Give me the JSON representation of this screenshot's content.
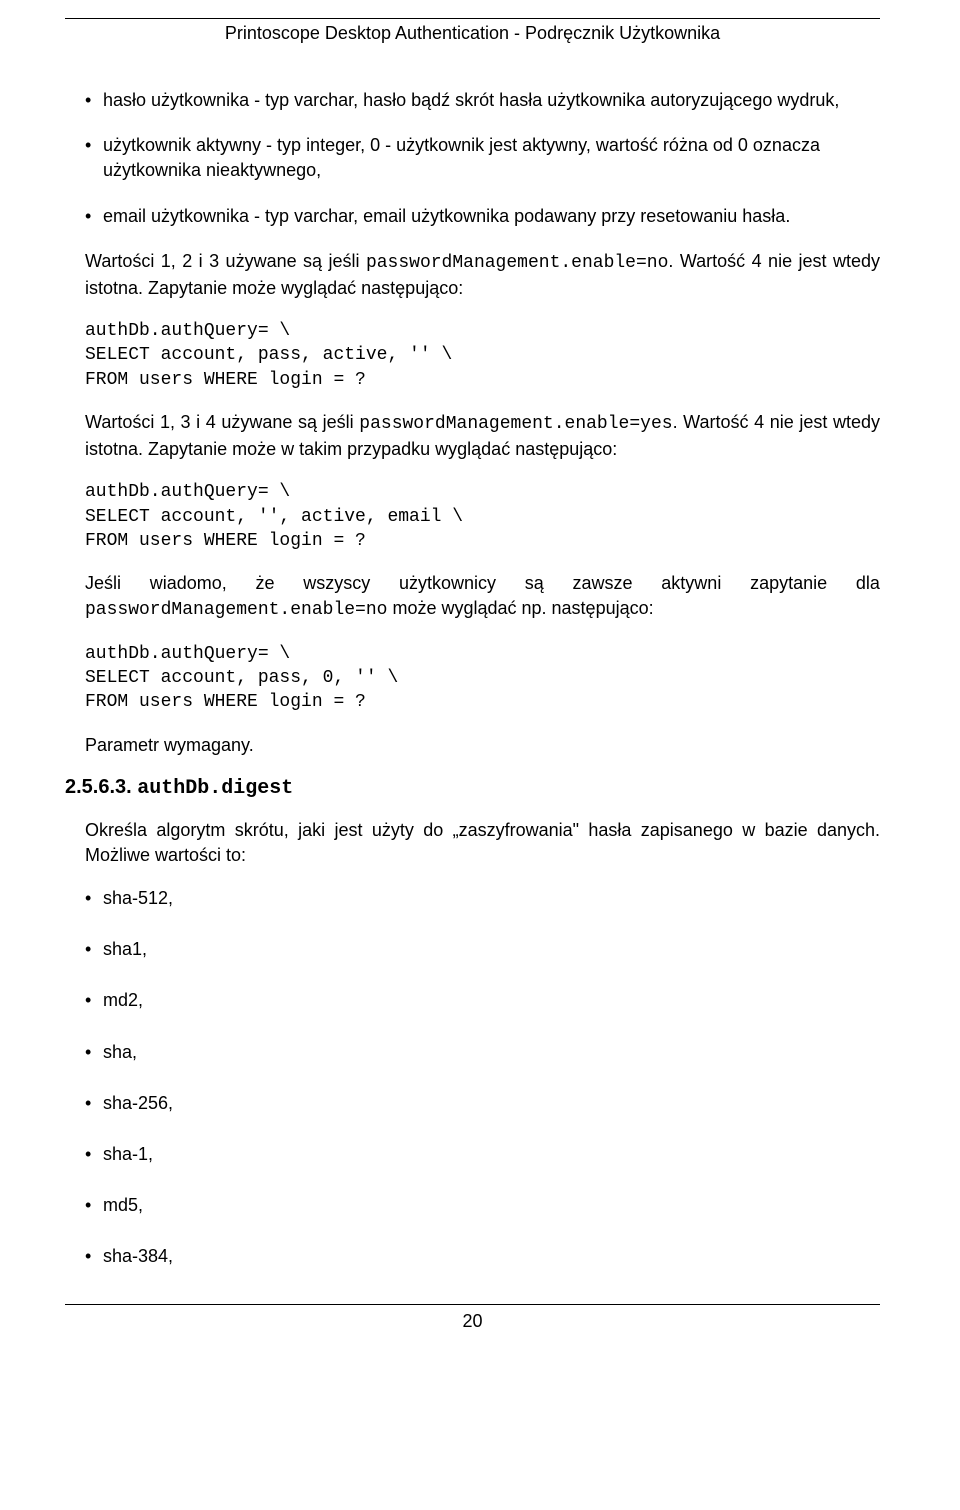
{
  "header": {
    "title": "Printoscope Desktop Authentication - Podręcznik Użytkownika"
  },
  "bullets_top": [
    "hasło użytkownika - typ varchar, hasło bądź skrót hasła użytkownika autoryzującego wydruk,",
    "użytkownik aktywny - typ integer, 0 - użytkownik jest aktywny, wartość różna od 0 oznacza użytkownika nieaktywnego,",
    "email użytkownika - typ varchar, email użytkownika podawany przy resetowaniu hasła."
  ],
  "p1_a": "Wartości 1, 2 i 3 używane są jeśli ",
  "p1_code": "passwordManagement.enable=no",
  "p1_b": ". Wartość 4 nie jest wtedy istotna. Zapytanie może wyglądać następująco:",
  "code1": "authDb.authQuery= \\\nSELECT account, pass, active, '' \\\nFROM users WHERE login = ?",
  "p2_a": "Wartości 1, 3 i 4 używane są jeśli ",
  "p2_code": "passwordManagement.enable=yes",
  "p2_b": ". Wartość 4 nie jest wtedy istotna. Zapytanie może w takim przypadku wyglądać następująco:",
  "code2": "authDb.authQuery= \\\nSELECT account, '', active, email \\\nFROM users WHERE login = ?",
  "p3_words": [
    "Jeśli",
    "wiadomo,",
    "że",
    "wszyscy",
    "użytkownicy",
    "są",
    "zawsze",
    "aktywni",
    "zapytanie",
    "dla"
  ],
  "p3_code": "passwordManagement.enable=no",
  "p3_b": " może wyglądać np. następująco:",
  "code3": "authDb.authQuery= \\\nSELECT account, pass, 0, '' \\\nFROM users WHERE login = ?",
  "p4": "Parametr wymagany.",
  "section": {
    "num": "2.5.6.3. ",
    "code": "authDb.digest"
  },
  "p5": "Określa algorytm skrótu, jaki jest użyty do „zaszyfrowania\" hasła zapisanego w bazie danych. Możliwe wartości to:",
  "bullets_algos": [
    "sha-512,",
    "sha1,",
    "md2,",
    "sha,",
    "sha-256,",
    "sha-1,",
    "md5,",
    "sha-384,"
  ],
  "footer": {
    "page": "20"
  }
}
